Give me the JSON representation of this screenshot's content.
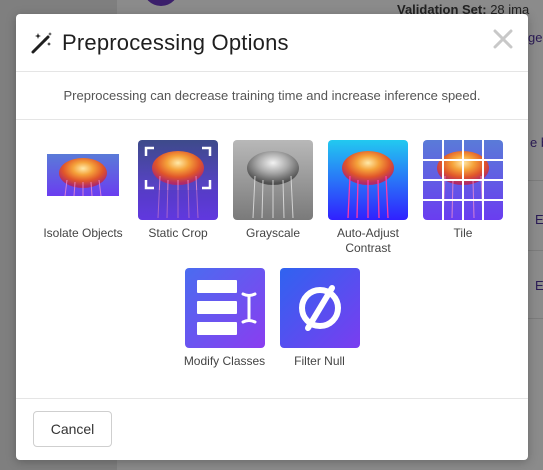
{
  "background": {
    "validation_label": "Validation Set:",
    "validation_value": "28 ima",
    "fragment_top_right": "ge",
    "fragment_mid_right": "e b",
    "fragment_e1": "E",
    "fragment_e2": "E"
  },
  "modal": {
    "title": "Preprocessing Options",
    "subtitle": "Preprocessing can decrease training time and increase inference speed.",
    "options_row1": [
      {
        "label": "Isolate Objects",
        "icon": "isolate-objects-thumbnail"
      },
      {
        "label": "Static Crop",
        "icon": "static-crop-thumbnail"
      },
      {
        "label": "Grayscale",
        "icon": "grayscale-thumbnail"
      },
      {
        "label": "Auto-Adjust Contrast",
        "icon": "auto-adjust-contrast-thumbnail"
      },
      {
        "label": "Tile",
        "icon": "tile-thumbnail"
      }
    ],
    "options_row2": [
      {
        "label": "Modify Classes",
        "icon": "modify-classes-icon"
      },
      {
        "label": "Filter Null",
        "icon": "filter-null-icon"
      }
    ],
    "cancel_label": "Cancel"
  },
  "colors": {
    "accent_purple": "#6a3df0",
    "accent_blue": "#3b6fe8",
    "overlay": "#8a8a8a"
  }
}
